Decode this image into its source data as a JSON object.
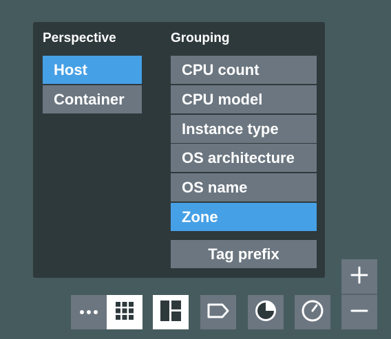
{
  "perspective": {
    "heading": "Perspective",
    "options": [
      {
        "label": "Host",
        "selected": true
      },
      {
        "label": "Container",
        "selected": false
      }
    ]
  },
  "grouping": {
    "heading": "Grouping",
    "options": [
      {
        "label": "CPU count",
        "selected": false
      },
      {
        "label": "CPU model",
        "selected": false
      },
      {
        "label": "Instance type",
        "selected": false
      },
      {
        "label": "OS architecture",
        "selected": false
      },
      {
        "label": "OS name",
        "selected": false
      },
      {
        "label": "Zone",
        "selected": true
      }
    ],
    "tag_prefix_label": "Tag prefix"
  },
  "toolbar": {
    "buttons": [
      {
        "icon": "more-icon",
        "active": false
      },
      {
        "icon": "grid-icon",
        "active": true
      },
      {
        "icon": "layout-icon",
        "active": true
      },
      {
        "icon": "tag-icon",
        "active": false
      },
      {
        "icon": "pie-chart-icon",
        "active": false
      },
      {
        "icon": "clock-icon",
        "active": false
      }
    ]
  },
  "zoom": {
    "in_icon": "plus-icon",
    "out_icon": "minus-icon"
  },
  "colors": {
    "background": "#465b5e",
    "panel": "#2e393c",
    "option": "#6b7680",
    "selected": "#46a0e6",
    "active_button": "#ffffff",
    "icon_dark": "#2e393c"
  }
}
